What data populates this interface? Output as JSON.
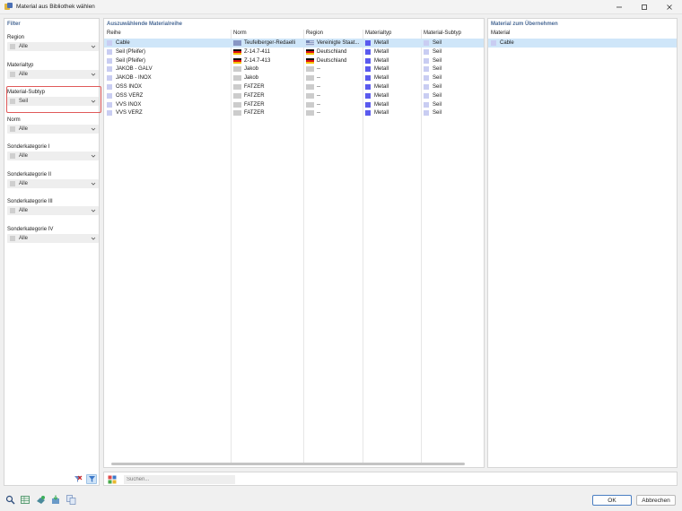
{
  "window": {
    "title": "Material aus Bibliothek wählen",
    "controls": [
      "minimize",
      "maximize",
      "close"
    ]
  },
  "filter": {
    "title": "Filter",
    "groups": [
      {
        "label": "Region",
        "value": "Alle"
      },
      {
        "label": "Materialtyp",
        "value": "Alle"
      },
      {
        "label": "Material-Subtyp",
        "value": "Seil",
        "highlighted": true
      },
      {
        "label": "Norm",
        "value": "Alle"
      },
      {
        "label": "Sonderkategorie I",
        "value": "Alle"
      },
      {
        "label": "Sonderkategorie II",
        "value": "Alle"
      },
      {
        "label": "Sonderkategorie III",
        "value": "Alle"
      },
      {
        "label": "Sonderkategorie IV",
        "value": "Alle"
      }
    ],
    "bottom_icons": [
      "clear-filter-icon",
      "filter-icon"
    ]
  },
  "materials": {
    "title": "Auszuwählende Materialreihe",
    "columns": [
      "Reihe",
      "Norm",
      "Region",
      "Materialtyp",
      "Material-Subtyp"
    ],
    "rows": [
      {
        "reihe": "Cable",
        "norm": "Teufelberger-Redaelli",
        "norm_icon": "logo",
        "region": "Vereinigte Staat...",
        "region_icon": "flag-us",
        "typ": "Metall",
        "subtyp": "Seil",
        "reihe_color": "#c9cdf2",
        "selected": true
      },
      {
        "reihe": "Seil (Pfeifer)",
        "norm": "Z-14.7-411",
        "norm_icon": "flag-de",
        "region": "Deutschland",
        "region_icon": "flag-de",
        "typ": "Metall",
        "subtyp": "Seil",
        "reihe_color": "#c9cdf2",
        "selected": false
      },
      {
        "reihe": "Seil (Pfeifer)",
        "norm": "Z-14.7-413",
        "norm_icon": "flag-de",
        "region": "Deutschland",
        "region_icon": "flag-de",
        "typ": "Metall",
        "subtyp": "Seil",
        "reihe_color": "#c9cdf2",
        "selected": false
      },
      {
        "reihe": "JAKOB - GALV",
        "norm": "Jakob",
        "norm_icon": "grey",
        "region": "--",
        "region_icon": "grey",
        "typ": "Metall",
        "subtyp": "Seil",
        "reihe_color": "#c9cdf2",
        "selected": false
      },
      {
        "reihe": "JAKOB - INOX",
        "norm": "Jakob",
        "norm_icon": "grey",
        "region": "--",
        "region_icon": "grey",
        "typ": "Metall",
        "subtyp": "Seil",
        "reihe_color": "#c9cdf2",
        "selected": false
      },
      {
        "reihe": "OSS INOX",
        "norm": "FATZER",
        "norm_icon": "grey",
        "region": "--",
        "region_icon": "grey",
        "typ": "Metall",
        "subtyp": "Seil",
        "reihe_color": "#c9cdf2",
        "selected": false
      },
      {
        "reihe": "OSS VERZ",
        "norm": "FATZER",
        "norm_icon": "grey",
        "region": "--",
        "region_icon": "grey",
        "typ": "Metall",
        "subtyp": "Seil",
        "reihe_color": "#c9cdf2",
        "selected": false
      },
      {
        "reihe": "VVS INOX",
        "norm": "FATZER",
        "norm_icon": "grey",
        "region": "--",
        "region_icon": "grey",
        "typ": "Metall",
        "subtyp": "Seil",
        "reihe_color": "#c9cdf2",
        "selected": false
      },
      {
        "reihe": "VVS VERZ",
        "norm": "FATZER",
        "norm_icon": "grey",
        "region": "--",
        "region_icon": "grey",
        "typ": "Metall",
        "subtyp": "Seil",
        "reihe_color": "#c9cdf2",
        "selected": false
      }
    ]
  },
  "search": {
    "placeholder": "Suchen..."
  },
  "selected": {
    "title": "Material zum Übernehmen",
    "column": "Material",
    "items": [
      {
        "name": "Cable",
        "color": "#c9cdf2",
        "selected": true
      }
    ]
  },
  "footer": {
    "icons": [
      "search-icon",
      "table-icon",
      "add-material-icon",
      "import-icon",
      "info-icon"
    ],
    "ok_label": "OK",
    "cancel_label": "Abbrechen"
  },
  "colors": {
    "accent": "#4a6a96",
    "selection": "#cfe6f9",
    "highlight_border": "#e05a5a",
    "metal_blue": "#5a5aee",
    "subtyp_light": "#c9cdf2"
  }
}
